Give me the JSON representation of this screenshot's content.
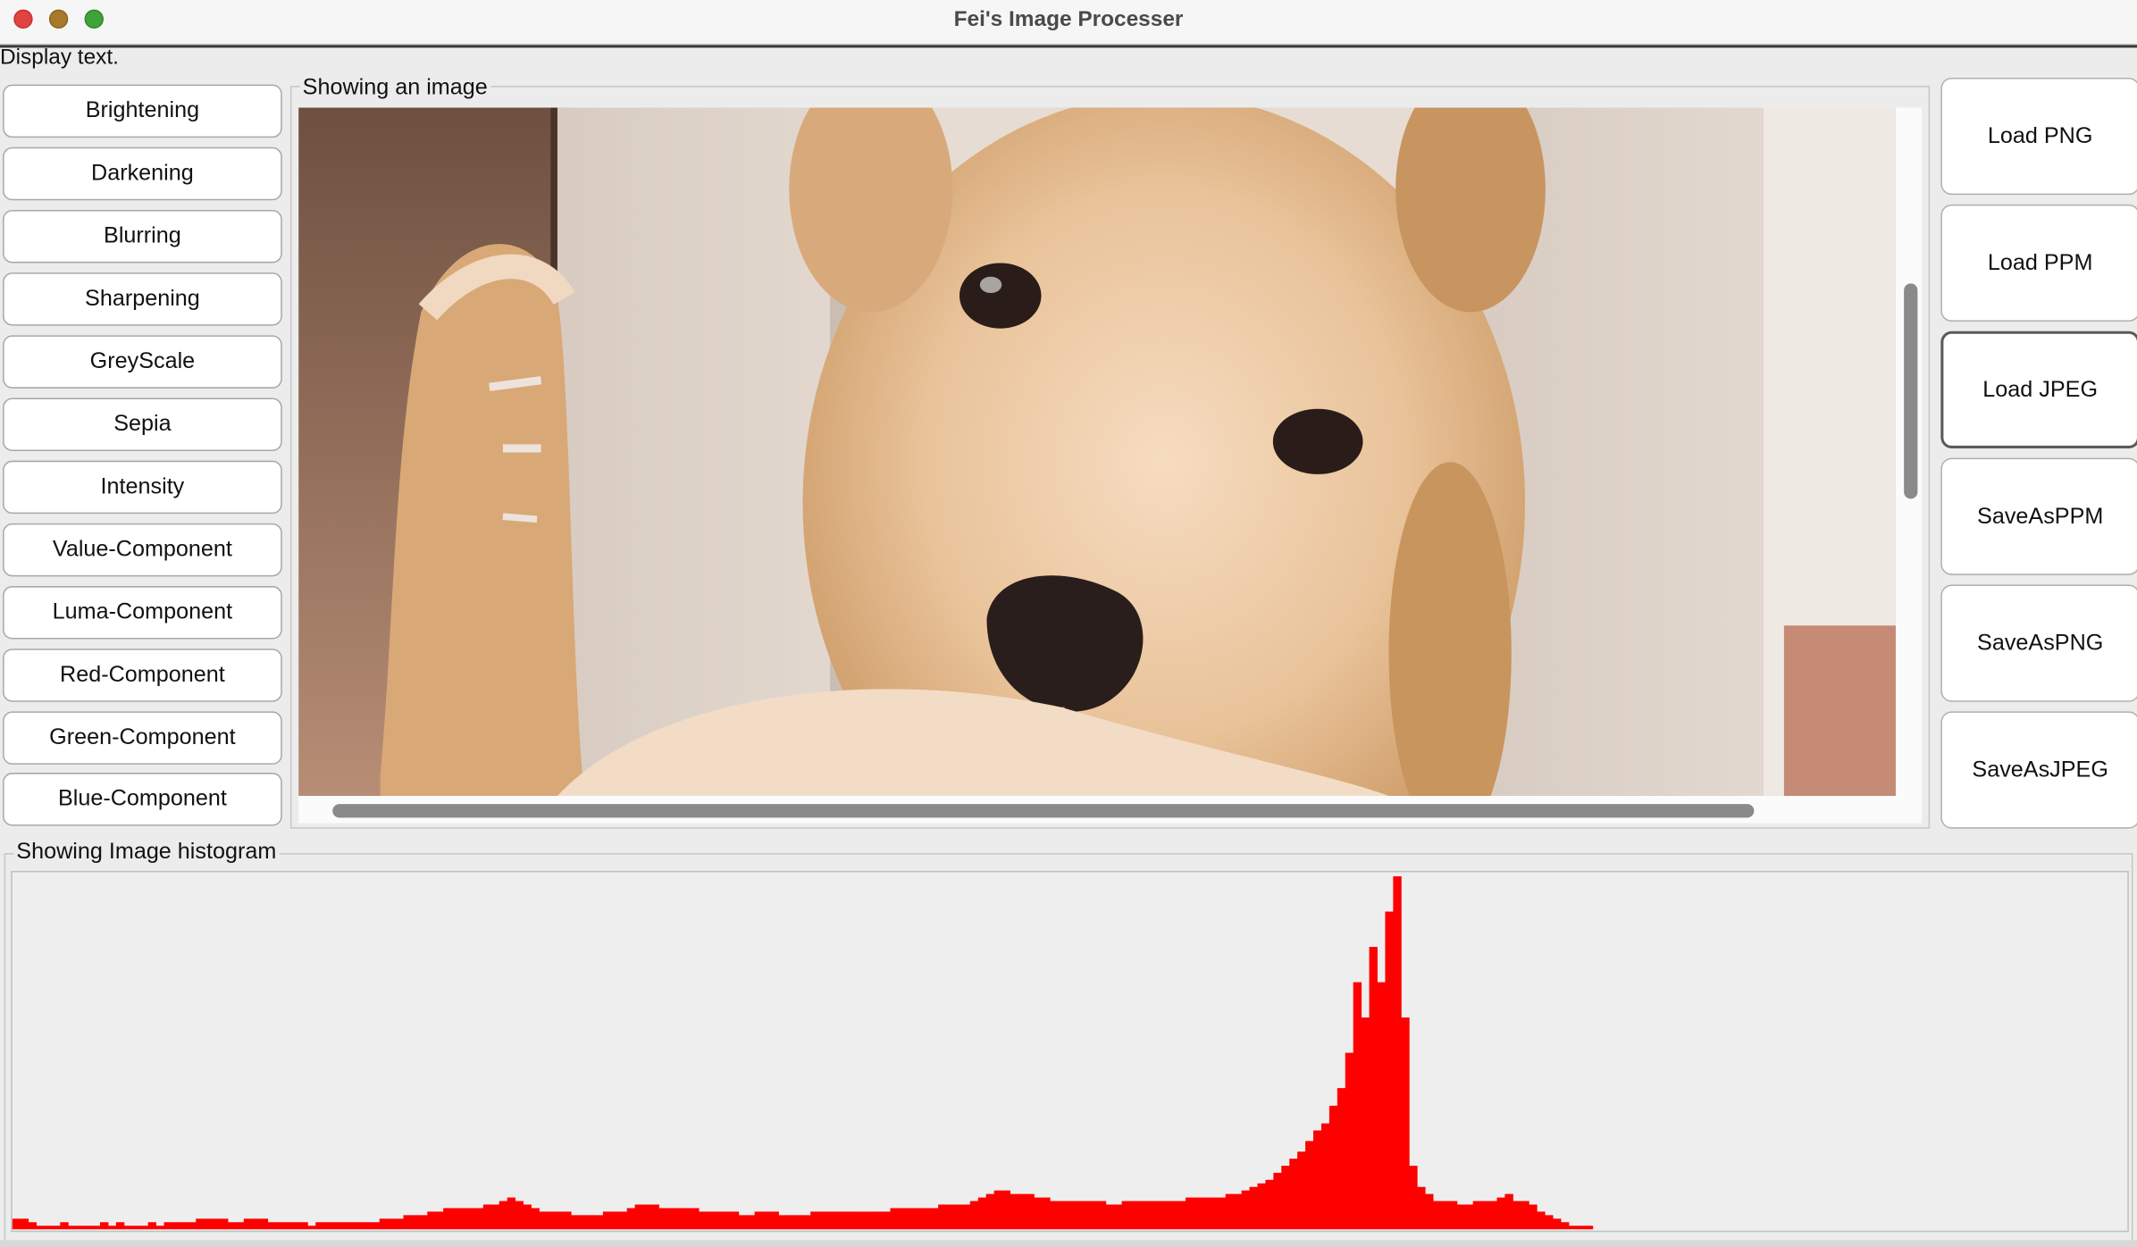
{
  "window": {
    "title": "Fei's Image Processer"
  },
  "display_text": "Display text.",
  "left_buttons": [
    "Brightening",
    "Darkening",
    "Blurring",
    "Sharpening",
    "GreyScale",
    "Sepia",
    "Intensity",
    "Value-Component",
    "Luma-Component",
    "Red-Component",
    "Green-Component",
    "Blue-Component"
  ],
  "image_panel": {
    "title": "Showing an image"
  },
  "right_buttons": [
    "Load PNG",
    "Load PPM",
    "Load JPEG",
    "SaveAsPPM",
    "SaveAsPNG",
    "SaveAsJPEG"
  ],
  "histogram_panel": {
    "title": "Showing Image histogram"
  },
  "colors": {
    "histogram_bar": "#ff0000",
    "panel_bg": "#ececec"
  },
  "chart_data": {
    "type": "bar",
    "xlim": [
      0,
      255
    ],
    "ylim": [
      0,
      100
    ],
    "series": [
      {
        "values": [
          3,
          3,
          2,
          1,
          1,
          1,
          2,
          1,
          1,
          1,
          1,
          2,
          1,
          2,
          1,
          1,
          1,
          2,
          1,
          2,
          2,
          2,
          2,
          3,
          3,
          3,
          3,
          2,
          2,
          3,
          3,
          3,
          2,
          2,
          2,
          2,
          2,
          1,
          2,
          2,
          2,
          2,
          2,
          2,
          2,
          2,
          3,
          3,
          3,
          4,
          4,
          4,
          5,
          5,
          6,
          6,
          6,
          6,
          6,
          7,
          7,
          8,
          9,
          8,
          7,
          6,
          5,
          5,
          5,
          5,
          4,
          4,
          4,
          4,
          5,
          5,
          5,
          6,
          7,
          7,
          7,
          6,
          6,
          6,
          6,
          6,
          5,
          5,
          5,
          5,
          5,
          4,
          4,
          5,
          5,
          5,
          4,
          4,
          4,
          4,
          5,
          5,
          5,
          5,
          5,
          5,
          5,
          5,
          5,
          5,
          6,
          6,
          6,
          6,
          6,
          6,
          7,
          7,
          7,
          7,
          8,
          9,
          10,
          11,
          11,
          10,
          10,
          10,
          9,
          9,
          8,
          8,
          8,
          8,
          8,
          8,
          8,
          7,
          7,
          8,
          8,
          8,
          8,
          8,
          8,
          8,
          8,
          9,
          9,
          9,
          9,
          9,
          10,
          10,
          11,
          12,
          13,
          14,
          16,
          18,
          20,
          22,
          25,
          28,
          30,
          35,
          40,
          50,
          70,
          60,
          80,
          70,
          90,
          100,
          60,
          18,
          12,
          10,
          8,
          8,
          8,
          7,
          7,
          8,
          8,
          8,
          9,
          10,
          8,
          8,
          7,
          5,
          4,
          3,
          2,
          1,
          1,
          1,
          0,
          0,
          0,
          0,
          0,
          0,
          0,
          0,
          0,
          0,
          0,
          0,
          0,
          0,
          0,
          0,
          0,
          0,
          0,
          0,
          0,
          0,
          0,
          0,
          0,
          0,
          0,
          0,
          0,
          0,
          0,
          0,
          0,
          0,
          0,
          0,
          0,
          0,
          0,
          0,
          0,
          0,
          0,
          0,
          0,
          0,
          0,
          0,
          0,
          0,
          0,
          0,
          0,
          0,
          0,
          0,
          0,
          0,
          0,
          0,
          0,
          0,
          0,
          0,
          0,
          0,
          0
        ]
      }
    ]
  }
}
